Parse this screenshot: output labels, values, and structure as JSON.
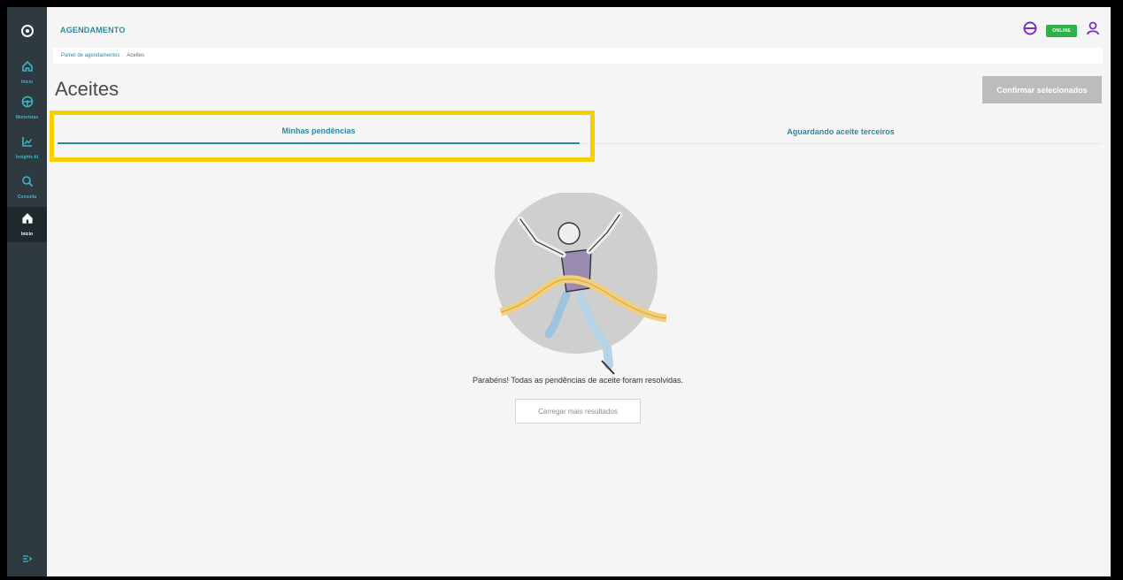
{
  "app": {
    "title": "AGENDAMENTO",
    "status_badge": "ONLINE"
  },
  "sidebar": {
    "items": [
      {
        "label": "Início",
        "icon": "home-icon"
      },
      {
        "label": "Motoristas",
        "icon": "steering-wheel-icon"
      },
      {
        "label": "Insights AI",
        "icon": "chart-icon"
      },
      {
        "label": "Consulta",
        "icon": "search-icon"
      },
      {
        "label": "Início",
        "icon": "home-icon",
        "active": true
      }
    ]
  },
  "breadcrumb": {
    "items": [
      "Painel de agendamentos",
      "Aceites"
    ]
  },
  "page": {
    "title": "Aceites",
    "confirm_button": "Confirmar selecionados"
  },
  "tabs": [
    {
      "label": "Minhas pendências",
      "active": true
    },
    {
      "label": "Aguardando aceite terceiros",
      "active": false
    }
  ],
  "empty_state": {
    "message": "Parabéns! Todas as pendências de aceite foram resolvidas.",
    "load_more": "Carregar mais resultados"
  },
  "colors": {
    "sidebar": "#2e3a40",
    "accent": "#2a8ba0",
    "online": "#2fb14a",
    "highlight": "#f6d000",
    "account_icon": "#7b2fbf"
  }
}
